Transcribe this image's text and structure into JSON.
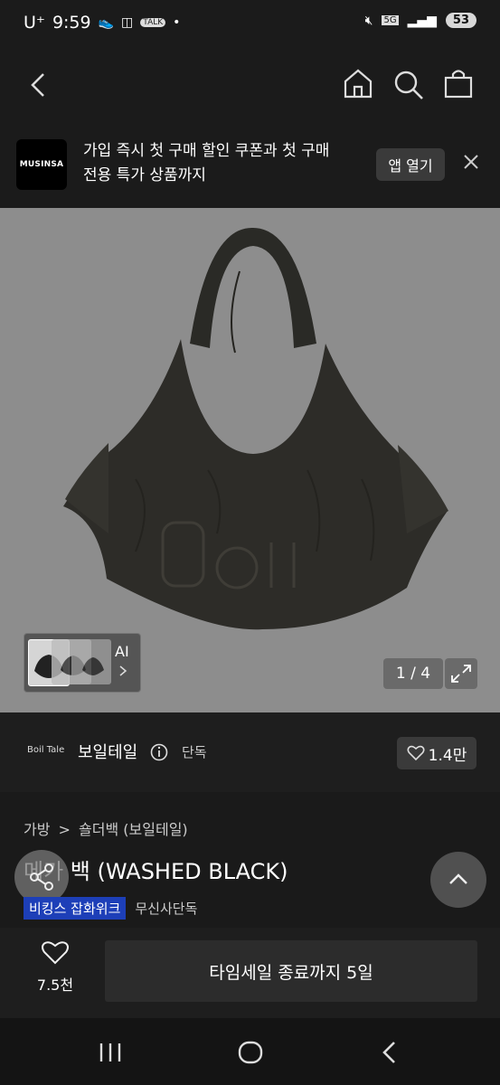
{
  "status_bar": {
    "carrier": "U⁺",
    "time": "9:59",
    "dot": "•",
    "network": "5G",
    "battery": "53"
  },
  "nav": {
    "back_icon": "chevron-left-icon",
    "home_icon": "home-icon",
    "search_icon": "search-icon",
    "cart_icon": "shopping-bag-icon"
  },
  "app_banner": {
    "logo_text": "MUSINSA",
    "message_line1": "가입 즉시 첫 구매 할인 쿠폰과 첫 구매",
    "message_line2": "전용 특가 상품까지",
    "open_label": "앱 열기",
    "close_icon": "close-icon"
  },
  "gallery": {
    "ai_label": "AI",
    "counter": "1 / 4",
    "current": 1,
    "total": 4
  },
  "brand": {
    "logo_text": "Boil Tale",
    "name": "보일테일",
    "exclusive_label": "단독",
    "likes": "1.4만"
  },
  "product": {
    "breadcrumb_1": "가방",
    "breadcrumb_sep": ">",
    "breadcrumb_2": "숄더백 (보일테일)",
    "title": "메가 백 (WASHED BLACK)",
    "tag_event": "비킹스 잡화위크",
    "tag_exclusive": "무신사단독"
  },
  "action_bar": {
    "wish_count": "7.5천",
    "sale_label": "타임세일 종료까지 5일"
  },
  "colors": {
    "background": "#1a1a1a",
    "hero_bg": "#8d8d8d",
    "tag_blue": "#1d3fb8"
  }
}
